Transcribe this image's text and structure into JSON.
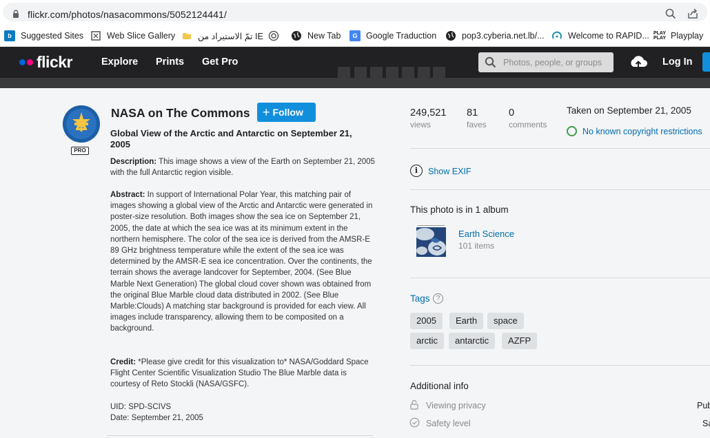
{
  "browser": {
    "url": "flickr.com/photos/nasacommons/5052124441/",
    "bookmarks": [
      {
        "label": "Suggested Sites",
        "icon": "bing-icon"
      },
      {
        "label": "Web Slice Gallery",
        "icon": "web-slice-icon"
      },
      {
        "label": "تمّ الاستيراد من IE",
        "icon": "folder-icon"
      },
      {
        "label": "",
        "icon": "target-icon"
      },
      {
        "label": "New Tab",
        "icon": "globe-icon"
      },
      {
        "label": "Google Traduction",
        "icon": "google-translate-icon"
      },
      {
        "label": "pop3.cyberia.net.lb/...",
        "icon": "globe-icon"
      },
      {
        "label": "Welcome to RAPID...",
        "icon": "rapid-icon"
      },
      {
        "label": "Playplay",
        "icon": "playplay-icon"
      }
    ]
  },
  "flickr_nav": {
    "logo": "flickr",
    "links": [
      "Explore",
      "Prints",
      "Get Pro"
    ],
    "search_placeholder": "Photos, people, or groups",
    "login": "Log In"
  },
  "owner": {
    "name": "NASA on The Commons",
    "badge": "PRO",
    "follow_label": "Follow"
  },
  "photo": {
    "title": "Global View of the Arctic and Antarctic on September 21, 2005",
    "description_label": "Description:",
    "description": " This image shows a view of the Earth on September 21, 2005 with the full Antarctic region visible.",
    "abstract_label": "Abstract:",
    "abstract": " In support of International Polar Year, this matching pair of images showing a global view of the Arctic and Antarctic were generated in poster-size resolution. Both images show the sea ice on September 21, 2005, the date at which the sea ice was at its minimum extent in the northern hemisphere. The color of the sea ice is derived from the AMSR-E 89 GHz brightness temperature while the extent of the sea ice was determined by the AMSR-E sea ice concentration. Over the continents, the terrain shows the average landcover for September, 2004. (See Blue Marble Next Generation) The global cloud cover shown was obtained from the original Blue Marble cloud data distributed in 2002. (See Blue Marble:Clouds) A matching star background is provided for each view. All images include transparency, allowing them to be composited on a background.",
    "credit_label": "Credit:",
    "credit": " *Please give credit for this visualization to* NASA/Goddard Space Flight Center Scientific Visualization Studio The Blue Marble data is courtesy of Reto Stockli (NASA/GSFC).",
    "uid": "UID: SPD-SCIVS",
    "date": "Date: September 21, 2005"
  },
  "stats": [
    {
      "value": "249,521",
      "label": "views"
    },
    {
      "value": "81",
      "label": "faves"
    },
    {
      "value": "0",
      "label": "comments"
    }
  ],
  "taken": "Taken on September 21, 2005",
  "license": "No known copyright restrictions",
  "exif_label": "Show EXIF",
  "album": {
    "heading": "This photo is in 1 album",
    "name": "Earth Science",
    "count": "101 items"
  },
  "tags": {
    "heading": "Tags",
    "items": [
      "2005",
      "Earth",
      "space",
      "arctic",
      "antarctic",
      "AZFP"
    ]
  },
  "additional": {
    "heading": "Additional info",
    "rows": [
      {
        "label": "Viewing privacy",
        "value": "Pub",
        "icon": "lock-open-icon"
      },
      {
        "label": "Safety level",
        "value": "Sa",
        "icon": "check-circle-icon"
      }
    ]
  },
  "colors": {
    "flickr_blue": "#0063dc",
    "flickr_pink": "#ff0084",
    "link": "#006dac",
    "follow_button": "#128fdc",
    "nav_bg": "#212124"
  }
}
